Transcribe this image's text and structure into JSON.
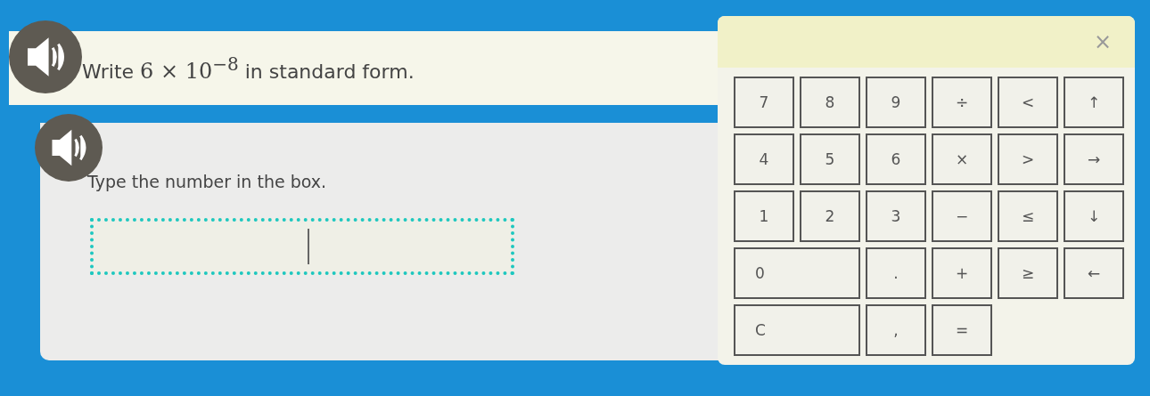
{
  "question": {
    "before": "Write",
    "math": "6 × 10$^{−8}$",
    "after": "in standard form."
  },
  "instruction": {
    "text": "Type the number in the box."
  },
  "answer": {
    "focused": true
  },
  "keypad": {
    "close": "×",
    "keys": [
      {
        "label": "7",
        "wide": false
      },
      {
        "label": "8",
        "wide": false
      },
      {
        "label": "9",
        "wide": false
      },
      {
        "label": "÷",
        "wide": false
      },
      {
        "label": "<",
        "wide": false
      },
      {
        "label": "↑",
        "wide": false
      },
      {
        "label": "4",
        "wide": false
      },
      {
        "label": "5",
        "wide": false
      },
      {
        "label": "6",
        "wide": false
      },
      {
        "label": "×",
        "wide": false
      },
      {
        "label": ">",
        "wide": false
      },
      {
        "label": "→",
        "wide": false
      },
      {
        "label": "1",
        "wide": false
      },
      {
        "label": "2",
        "wide": false
      },
      {
        "label": "3",
        "wide": false
      },
      {
        "label": "−",
        "wide": false
      },
      {
        "label": "≤",
        "wide": false
      },
      {
        "label": "↓",
        "wide": false
      },
      {
        "label": "0",
        "wide": true
      },
      {
        "label": ".",
        "wide": false
      },
      {
        "label": "+",
        "wide": false
      },
      {
        "label": "≥",
        "wide": false
      },
      {
        "label": "←",
        "wide": false
      },
      {
        "label": "C",
        "wide": true
      },
      {
        "label": ",",
        "wide": false
      },
      {
        "label": "=",
        "wide": false
      }
    ]
  }
}
